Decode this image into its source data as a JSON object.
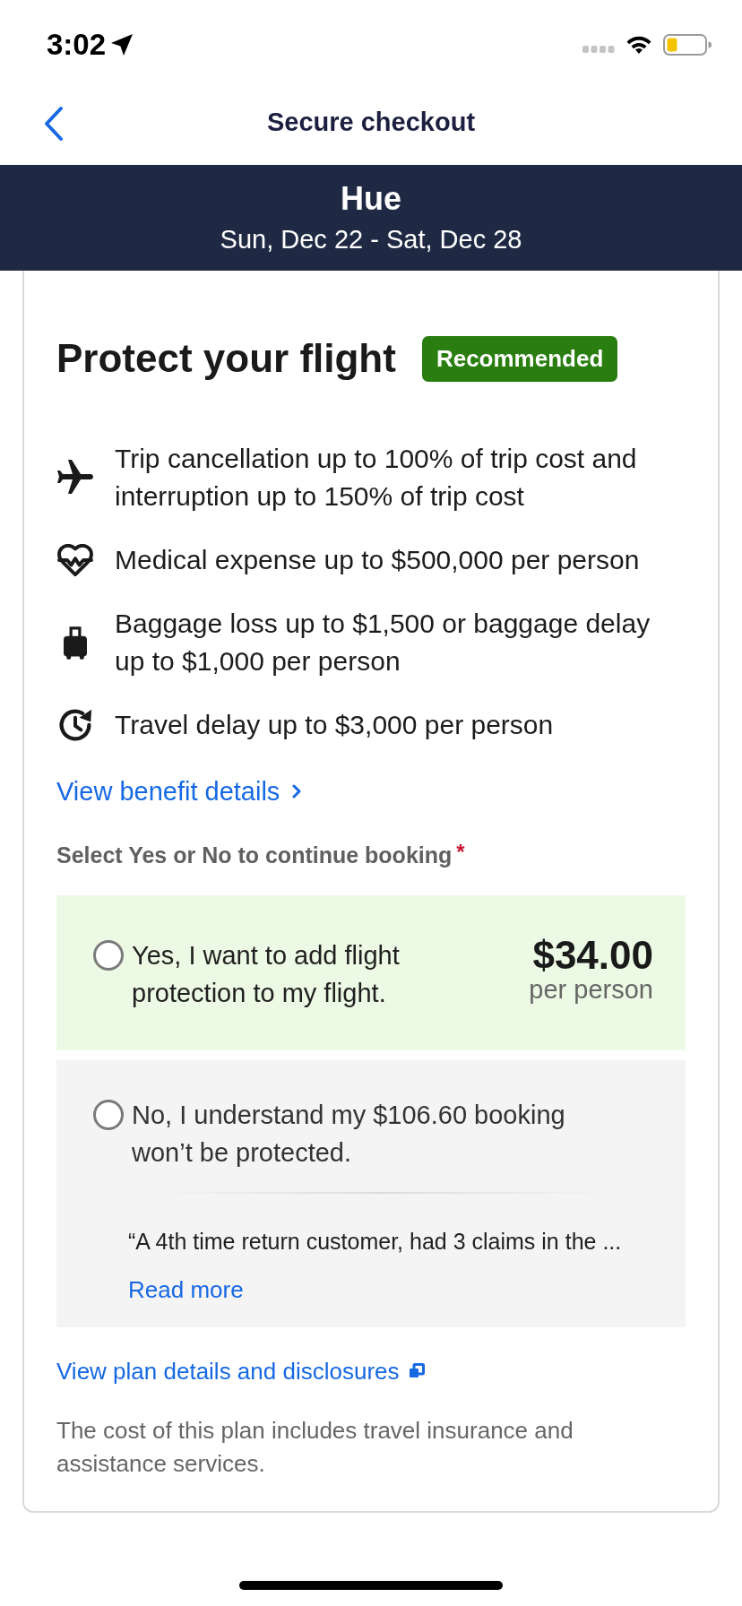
{
  "status_bar": {
    "time": "3:02"
  },
  "nav": {
    "title": "Secure checkout"
  },
  "trip_banner": {
    "destination": "Hue",
    "dates": "Sun, Dec 22 - Sat, Dec 28"
  },
  "card": {
    "title": "Protect your flight",
    "badge": "Recommended",
    "benefits": [
      {
        "kind": "plane",
        "text": "Trip cancellation up to 100% of trip cost and interruption up to 150% of trip cost"
      },
      {
        "kind": "medical",
        "text": "Medical expense up to $500,000 per person"
      },
      {
        "kind": "baggage",
        "text": "Baggage loss up to $1,500 or baggage delay up to $1,000 per person"
      },
      {
        "kind": "delay",
        "text": "Travel delay up to $3,000 per person"
      }
    ],
    "benefit_link": "View benefit details",
    "prompt": {
      "label": "Select Yes or No to continue booking",
      "required_mark": "*"
    },
    "options": [
      {
        "kind": "yes",
        "selected": false,
        "label": "Yes, I want to add flight protection to my flight.",
        "price": "$34.00",
        "price_unit": "per person"
      },
      {
        "kind": "no",
        "selected": false,
        "label": "No, I understand my $106.60 booking won’t be protected.",
        "quote": "“A 4th time return customer, had 3 claims in the ...",
        "quote_link": "Read more"
      }
    ],
    "plan_link": "View plan details and disclosures",
    "note": "The cost of this plan includes travel insurance and assistance services."
  }
}
